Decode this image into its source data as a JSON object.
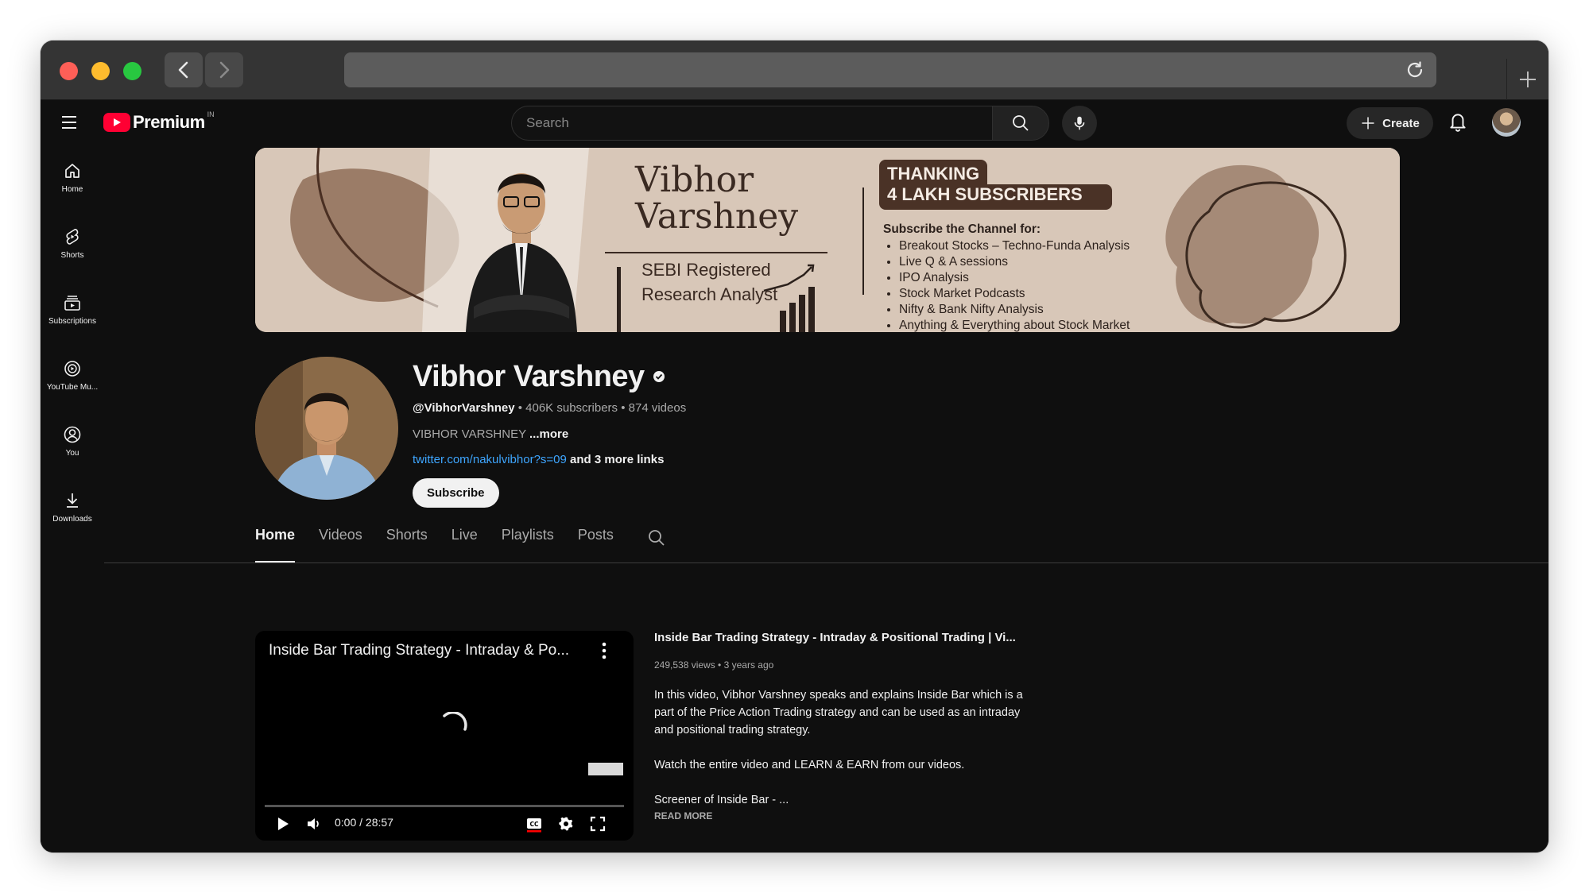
{
  "browser": {
    "back_icon": "chevron-left-icon",
    "forward_icon": "chevron-right-icon",
    "reload_icon": "reload-icon",
    "new_tab_icon": "plus-icon"
  },
  "masthead": {
    "brand": "Premium",
    "country_code": "IN",
    "search_placeholder": "Search",
    "create_label": "Create"
  },
  "guide": {
    "items": [
      {
        "label": "Home",
        "icon": "home-icon"
      },
      {
        "label": "Shorts",
        "icon": "shorts-icon"
      },
      {
        "label": "Subscriptions",
        "icon": "subscriptions-icon"
      },
      {
        "label": "YouTube Mu...",
        "icon": "youtube-music-icon"
      },
      {
        "label": "You",
        "icon": "you-icon"
      },
      {
        "label": "Downloads",
        "icon": "download-icon"
      }
    ]
  },
  "banner": {
    "name_line1": "Vibhor",
    "name_line2": "Varshney",
    "role_line1": "SEBI Registered",
    "role_line2": "Research Analyst",
    "thanks_line1": "THANKING",
    "thanks_line2": "4 LAKH SUBSCRIBERS",
    "subscribe_heading": "Subscribe the Channel for:",
    "bullets": [
      "Breakout Stocks – Techno-Funda Analysis",
      "Live Q & A sessions",
      "IPO Analysis",
      "Stock Market Podcasts",
      "Nifty & Bank Nifty Analysis",
      "Anything & Everything about Stock Market"
    ]
  },
  "channel": {
    "name": "Vibhor Varshney",
    "handle": "@VibhorVarshney",
    "subscribers": "406K subscribers",
    "videos": "874 videos",
    "description": "VIBHOR VARSHNEY",
    "more_label": "...more",
    "link": "twitter.com/nakulvibhor?s=09",
    "more_links": "and 3 more links",
    "subscribe_label": "Subscribe"
  },
  "tabs": [
    {
      "label": "Home",
      "active": true
    },
    {
      "label": "Videos",
      "active": false
    },
    {
      "label": "Shorts",
      "active": false
    },
    {
      "label": "Live",
      "active": false
    },
    {
      "label": "Playlists",
      "active": false
    },
    {
      "label": "Posts",
      "active": false
    }
  ],
  "featured": {
    "player_title": "Inside Bar Trading Strategy - Intraday & Po...",
    "time": "0:00 / 28:57",
    "progress": 0,
    "title": "Inside Bar Trading Strategy - Intraday & Positional Trading | Vi...",
    "stats": "249,538 views • 3 years ago",
    "description_paragraphs": [
      "In this video, Vibhor Varshney speaks and explains Inside Bar which is a part of the Price Action Trading strategy and can be used as an intraday and positional trading strategy.",
      "Watch the entire video and LEARN & EARN from our videos.",
      "Screener of Inside Bar - ..."
    ],
    "read_more": "READ MORE"
  }
}
